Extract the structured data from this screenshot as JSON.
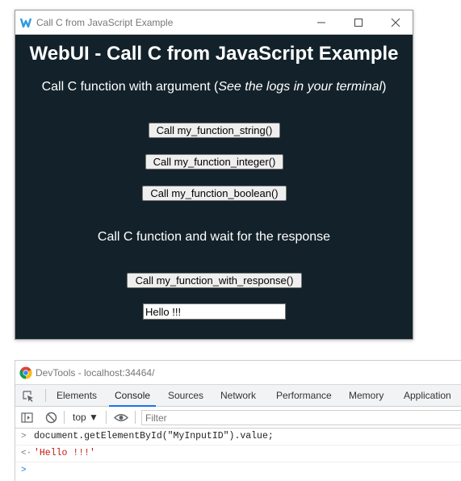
{
  "app_window": {
    "title": "Call C from JavaScript Example",
    "heading": "WebUI - Call C from JavaScript Example",
    "subheading_prefix": "Call C function with argument (",
    "subheading_italic": "See the logs in your terminal",
    "subheading_suffix": ")",
    "buttons": [
      "Call my_function_string()",
      "Call my_function_integer()",
      "Call my_function_boolean()"
    ],
    "subheading2": "Call C function and wait for the response",
    "response_button": "Call my_function_with_response()",
    "input_value": "Hello !!!"
  },
  "devtools": {
    "title": "DevTools - localhost:34464/",
    "tabs": [
      "Elements",
      "Console",
      "Sources",
      "Network",
      "Performance",
      "Memory",
      "Application"
    ],
    "active_tab": "Console",
    "context": "top ▼",
    "filter_placeholder": "Filter",
    "console_lines": [
      {
        "prompt": ">",
        "text": "document.getElementById(\"MyInputID\").value;"
      },
      {
        "prompt": "<·",
        "text": "'Hello !!!'"
      },
      {
        "prompt": ">",
        "text": ""
      }
    ]
  },
  "colors": {
    "app_bg": "#13222a",
    "accent_tab": "#1a73e8",
    "console_string": "#c41a16"
  }
}
